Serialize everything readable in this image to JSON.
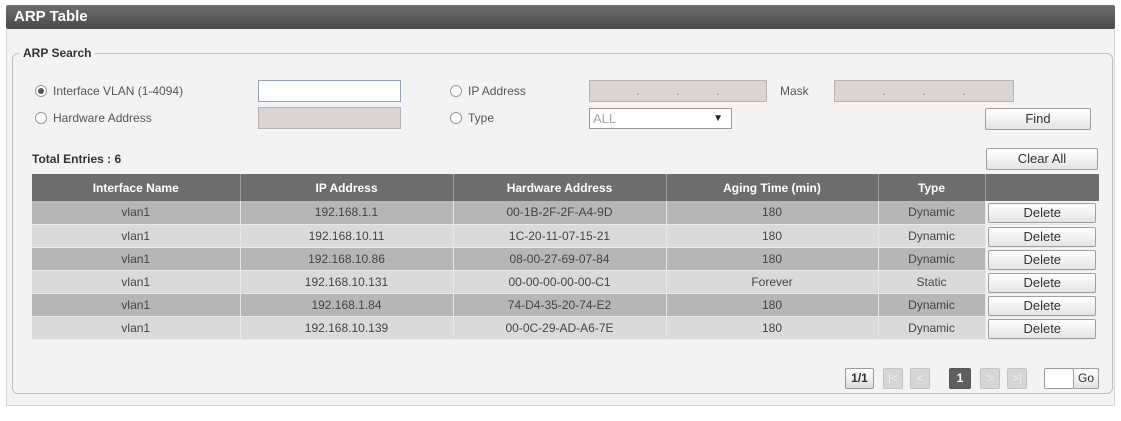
{
  "title": "ARP Table",
  "search": {
    "legend": "ARP Search",
    "interface_vlan_label": "Interface VLAN (1-4094)",
    "interface_vlan_value": "",
    "hardware_address_label": "Hardware Address",
    "ip_address_label": "IP Address",
    "mask_label": "Mask",
    "type_label": "Type",
    "type_selected": "ALL",
    "find_label": "Find",
    "selected_option": "interface_vlan"
  },
  "table": {
    "total_entries": "Total Entries : 6",
    "clear_all_label": "Clear All",
    "columns": [
      "Interface Name",
      "IP Address",
      "Hardware Address",
      "Aging Time (min)",
      "Type",
      ""
    ],
    "delete_label": "Delete",
    "rows": [
      {
        "interface": "vlan1",
        "ip": "192.168.1.1",
        "mac": "00-1B-2F-2F-A4-9D",
        "aging": "180",
        "type": "Dynamic"
      },
      {
        "interface": "vlan1",
        "ip": "192.168.10.11",
        "mac": "1C-20-11-07-15-21",
        "aging": "180",
        "type": "Dynamic"
      },
      {
        "interface": "vlan1",
        "ip": "192.168.10.86",
        "mac": "08-00-27-69-07-84",
        "aging": "180",
        "type": "Dynamic"
      },
      {
        "interface": "vlan1",
        "ip": "192.168.10.131",
        "mac": "00-00-00-00-00-C1",
        "aging": "Forever",
        "type": "Static"
      },
      {
        "interface": "vlan1",
        "ip": "192.168.1.84",
        "mac": "74-D4-35-20-74-E2",
        "aging": "180",
        "type": "Dynamic"
      },
      {
        "interface": "vlan1",
        "ip": "192.168.10.139",
        "mac": "00-0C-29-AD-A6-7E",
        "aging": "180",
        "type": "Dynamic"
      }
    ]
  },
  "pagination": {
    "page_info": "1/1",
    "first": "|<",
    "prev": "<",
    "current": "1",
    "next": ">",
    "last": ">|",
    "go_label": "Go"
  }
}
